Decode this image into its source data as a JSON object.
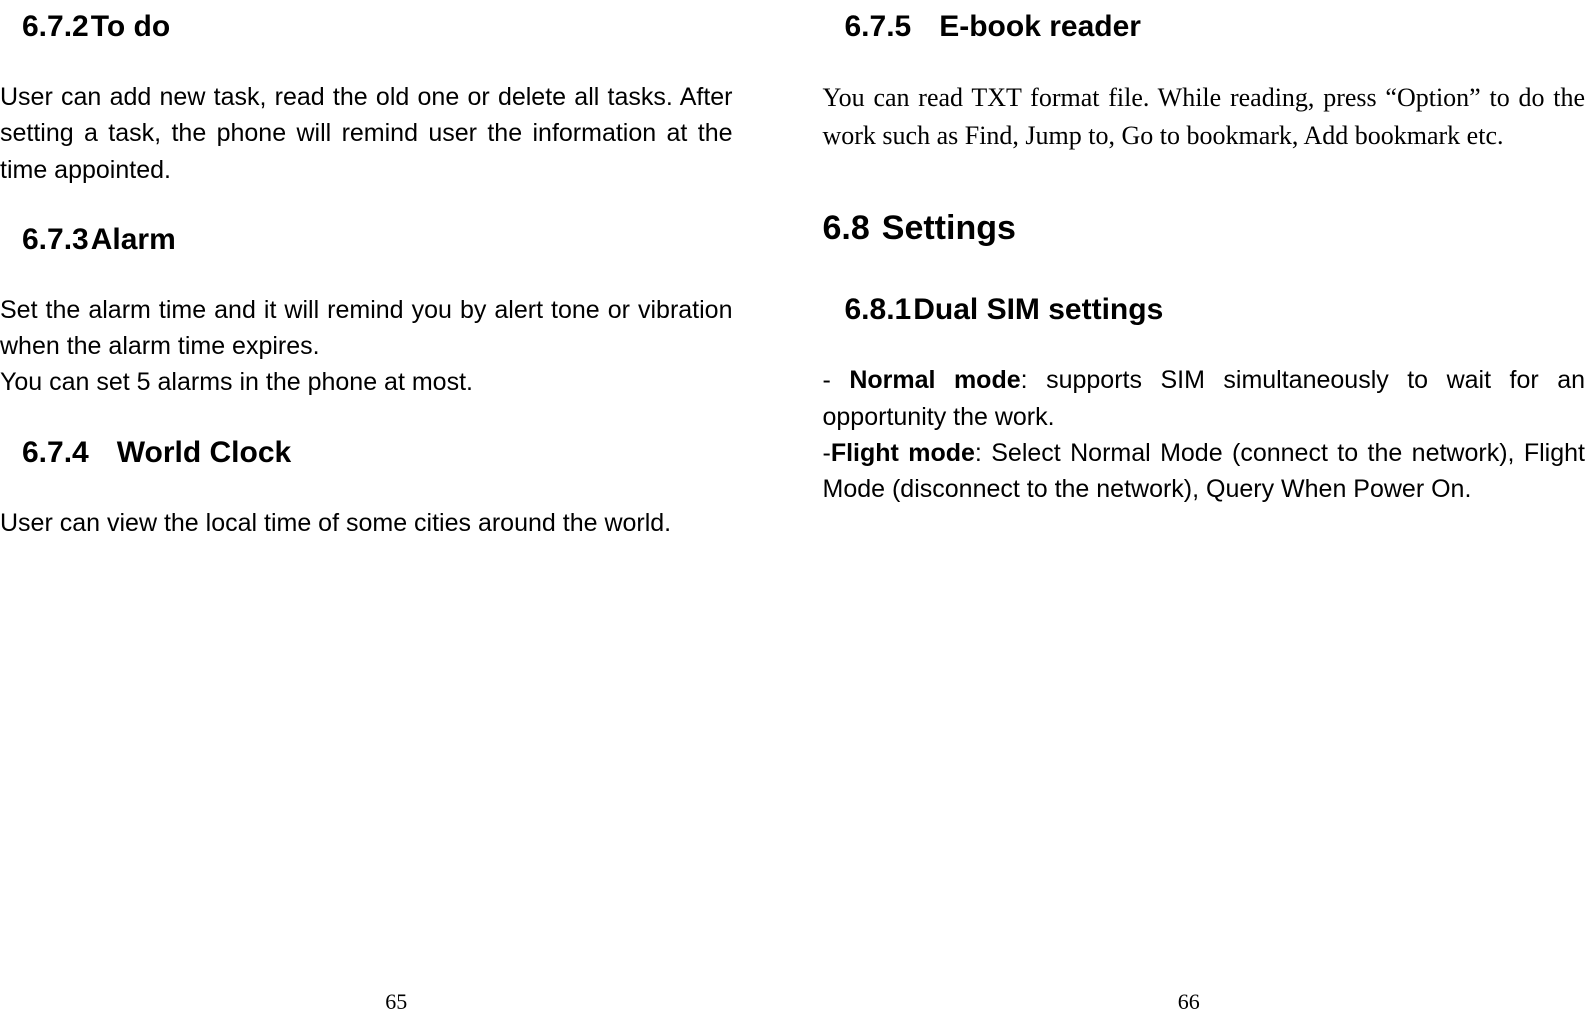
{
  "leftPage": {
    "sections": [
      {
        "number": "6.7.2",
        "title": "To do",
        "paragraphs": [
          "User can add new task, read the old one or delete all tasks. After setting a task, the phone will remind user the information at the time appointed."
        ]
      },
      {
        "number": "6.7.3",
        "title": "Alarm",
        "paragraphs": [
          "Set the alarm time and it will remind you by alert tone or vibration when the alarm time expires.",
          "You can set 5 alarms in the phone at most."
        ]
      },
      {
        "number": "6.7.4",
        "title": "World Clock",
        "paragraphs": [
          "User can view the local time of some cities around the world."
        ]
      }
    ],
    "pageNumber": "65"
  },
  "rightPage": {
    "topSection": {
      "number": "6.7.5",
      "title": "E-book reader",
      "paragraph": "You can read TXT format file. While reading, press “Option” to do the work such as Find, Jump to, Go to bookmark, Add bookmark etc."
    },
    "mainSection": {
      "number": "6.8",
      "title": "Settings"
    },
    "subSection": {
      "number": "6.8.1",
      "title": "Dual SIM settings",
      "items": [
        {
          "prefix": "- ",
          "boldLabel": "Normal mode",
          "text": ": supports SIM simultaneously to wait for an opportunity the work."
        },
        {
          "prefix": "-",
          "boldLabel": "Flight mode",
          "text": ": Select Normal Mode (connect to the network), Flight Mode (disconnect to the network), Query When Power On."
        }
      ]
    },
    "pageNumber": "66"
  }
}
